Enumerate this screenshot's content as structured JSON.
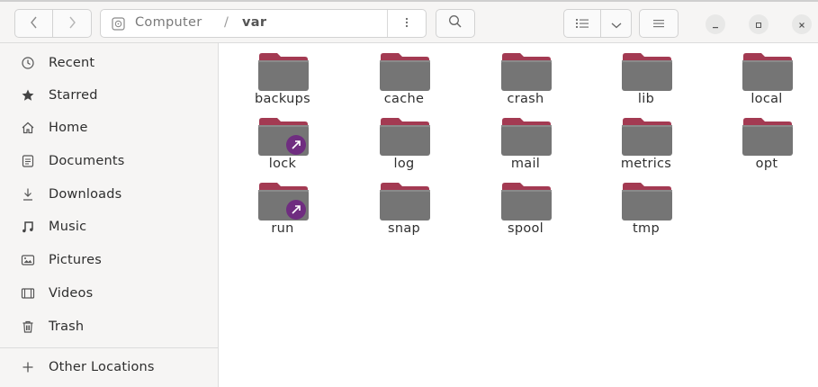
{
  "header": {
    "path_root": "Computer",
    "path_separator": "/",
    "path_current": "var",
    "icons": {
      "back": "chevron-left-icon",
      "forward": "chevron-right-icon",
      "path_root": "drive-icon",
      "path_menu": "vertical-ellipsis-icon",
      "search": "search-icon",
      "view_list": "list-view-icon",
      "view_dropdown": "chevron-down-icon",
      "menu": "hamburger-icon",
      "minimize": "minimize-icon",
      "maximize": "maximize-icon",
      "close": "close-icon"
    }
  },
  "sidebar": {
    "items": [
      {
        "label": "Recent",
        "icon": "clock-icon"
      },
      {
        "label": "Starred",
        "icon": "star-icon"
      },
      {
        "label": "Home",
        "icon": "home-icon"
      },
      {
        "label": "Documents",
        "icon": "document-icon"
      },
      {
        "label": "Downloads",
        "icon": "download-icon"
      },
      {
        "label": "Music",
        "icon": "music-icon"
      },
      {
        "label": "Pictures",
        "icon": "picture-icon"
      },
      {
        "label": "Videos",
        "icon": "video-icon"
      },
      {
        "label": "Trash",
        "icon": "trash-icon"
      }
    ],
    "other_locations": {
      "label": "Other Locations",
      "icon": "plus-icon"
    }
  },
  "folders": [
    {
      "name": "backups",
      "symlink": false
    },
    {
      "name": "cache",
      "symlink": false
    },
    {
      "name": "crash",
      "symlink": false
    },
    {
      "name": "lib",
      "symlink": false
    },
    {
      "name": "local",
      "symlink": false
    },
    {
      "name": "lock",
      "symlink": true
    },
    {
      "name": "log",
      "symlink": false
    },
    {
      "name": "mail",
      "symlink": false
    },
    {
      "name": "metrics",
      "symlink": false
    },
    {
      "name": "opt",
      "symlink": false
    },
    {
      "name": "run",
      "symlink": true
    },
    {
      "name": "snap",
      "symlink": false
    },
    {
      "name": "spool",
      "symlink": false
    },
    {
      "name": "tmp",
      "symlink": false
    }
  ],
  "colors": {
    "folder_tab": "#a33a52",
    "folder_body": "#757575",
    "symlink_badge": "#6f2d80"
  }
}
